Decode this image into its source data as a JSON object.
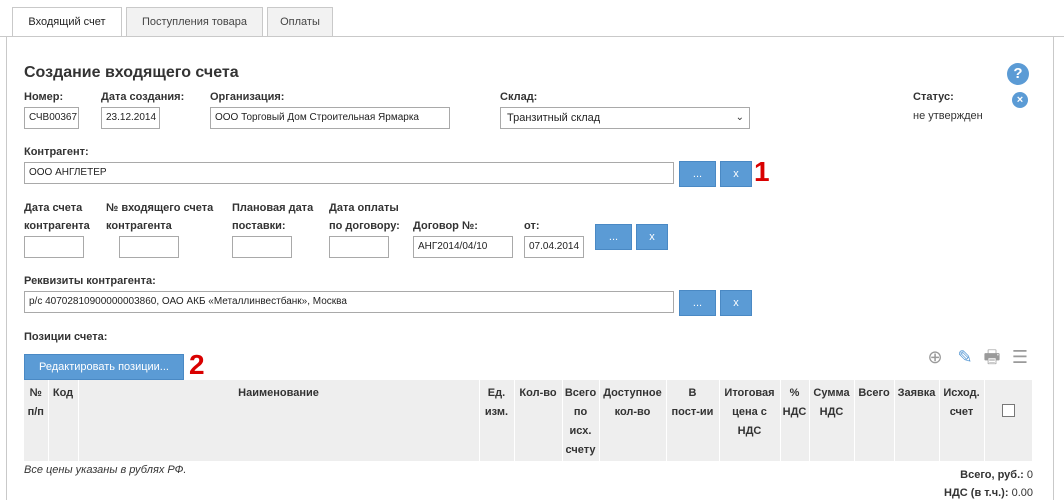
{
  "tabs": [
    "Входящий счет",
    "Поступления товара",
    "Оплаты"
  ],
  "page_title": "Создание входящего счета",
  "help_icon": "?",
  "close_icon": "×",
  "number": {
    "label": "Номер:",
    "value": "СЧВ00367"
  },
  "created_date": {
    "label": "Дата создания:",
    "value": "23.12.2014"
  },
  "organization": {
    "label": "Организация:",
    "value": "ООО Торговый Дом Строительная Ярмарка"
  },
  "warehouse": {
    "label": "Склад:",
    "value": "Транзитный склад",
    "chevron": "⌄"
  },
  "status": {
    "label": "Статус:",
    "value": "не утвержден"
  },
  "counterparty": {
    "label": "Контрагент:",
    "value": "ООО АНГЛЕТЕР",
    "browse": "...",
    "clear": "x",
    "marker": "1"
  },
  "counterparty_invoice_date": {
    "label_line1": "Дата счета",
    "label_line2": "контрагента",
    "value": ""
  },
  "incoming_invoice_number": {
    "label_line1": "№ входящего счета",
    "label_line2": "контрагента",
    "value": ""
  },
  "planned_delivery_date": {
    "label_line1": "Плановая дата",
    "label_line2": "поставки:",
    "value": ""
  },
  "contract_payment_date": {
    "label_line1": "Дата оплаты",
    "label_line2": "по договору:",
    "value": ""
  },
  "contract": {
    "label": "Договор №:",
    "value": "АНГ2014/04/10",
    "date_label": "от:",
    "date_value": "07.04.2014",
    "browse": "...",
    "clear": "x"
  },
  "requisites": {
    "label": "Реквизиты контрагента:",
    "value": "р/с 40702810900000003860, ОАО АКБ «Металлинвестбанк», Москва",
    "browse": "...",
    "clear": "x"
  },
  "positions": {
    "label": "Позиции счета:",
    "edit_button": "Редактировать позиции...",
    "marker": "2",
    "toolbar": {
      "add": "⊕",
      "edit": "✎",
      "print": "🖶",
      "menu": "☰"
    },
    "columns": [
      [
        "№",
        "п/п"
      ],
      [
        "Код"
      ],
      [
        "Наименование"
      ],
      [
        "Ед.",
        "изм."
      ],
      [
        "Кол-во"
      ],
      [
        "Всего",
        "по",
        "исх.",
        "счету"
      ],
      [
        "Доступное",
        "кол-во"
      ],
      [
        "В",
        "пост-ии"
      ],
      [
        "Итоговая",
        "цена с",
        "НДС"
      ],
      [
        "%",
        "НДС"
      ],
      [
        "Сумма",
        "НДС"
      ],
      [
        "Всего"
      ],
      [
        "Заявка"
      ],
      [
        "Исход.",
        "счет"
      ]
    ]
  },
  "footnote": "Все цены указаны в рублях РФ.",
  "totals": {
    "total_label": "Всего, руб.:",
    "total_value": "0",
    "vat_label": "НДС (в т.ч.):",
    "vat_value": "0.00"
  }
}
